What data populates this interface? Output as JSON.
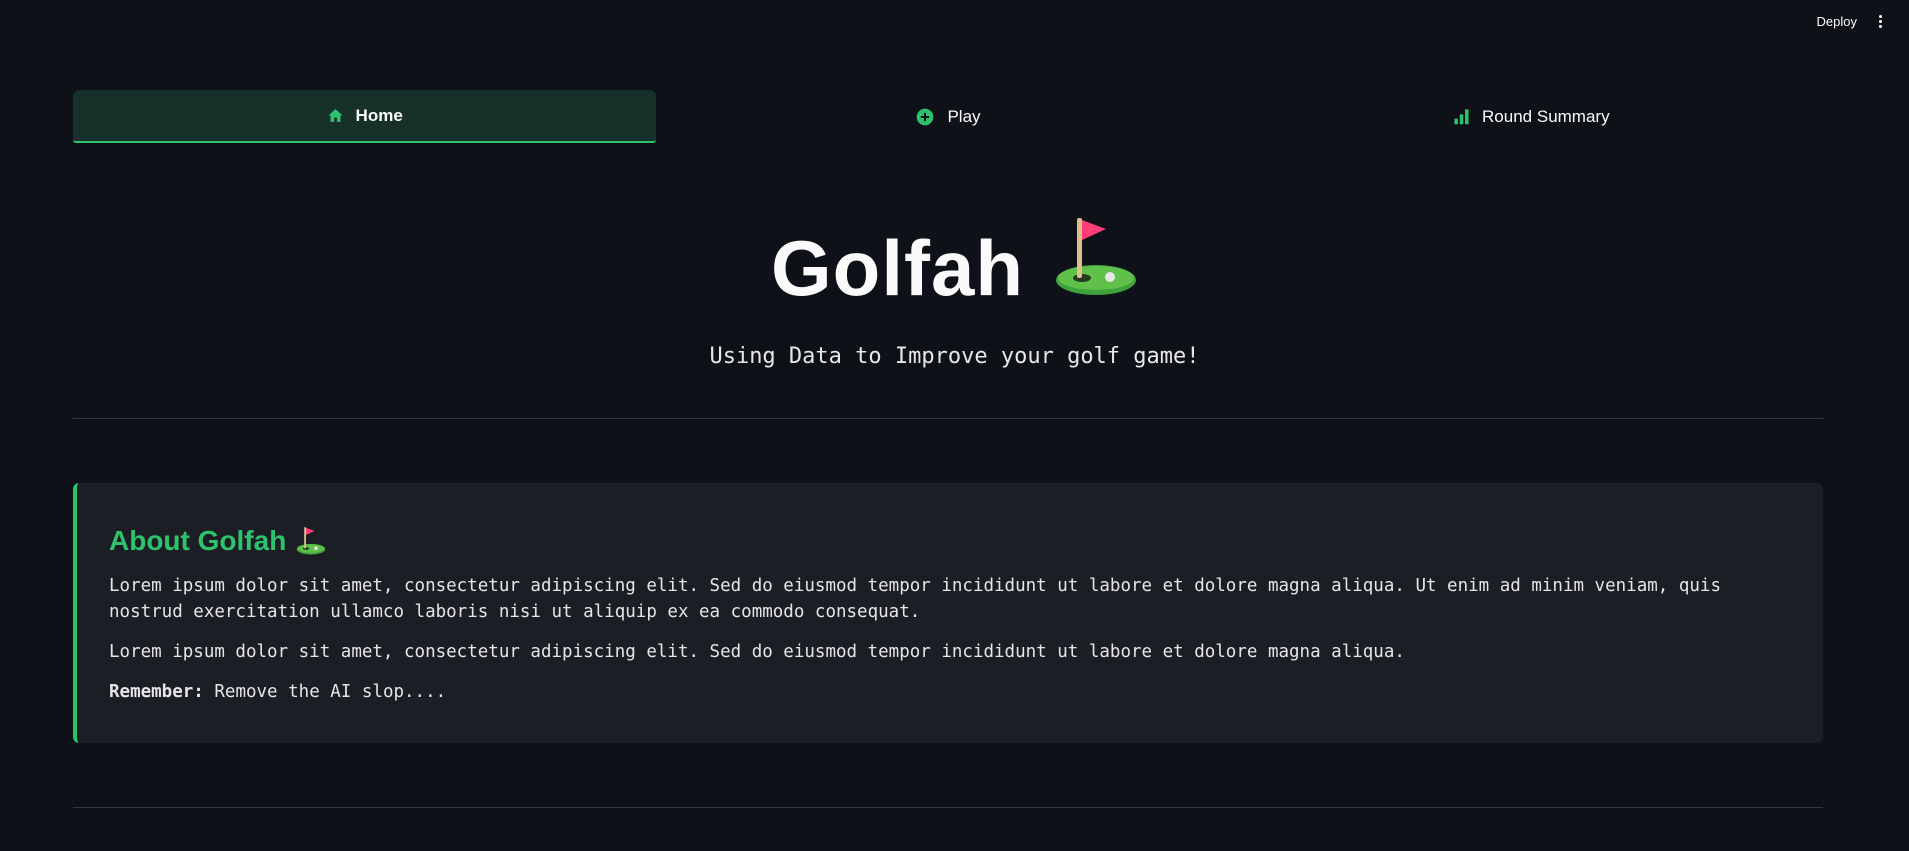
{
  "header": {
    "deploy_label": "Deploy"
  },
  "nav": {
    "tabs": [
      {
        "label": "Home",
        "icon": "home-icon",
        "active": true
      },
      {
        "label": "Play",
        "icon": "plus-circle-icon",
        "active": false
      },
      {
        "label": "Round Summary",
        "icon": "bar-chart-icon",
        "active": false
      }
    ]
  },
  "hero": {
    "title": "Golfah",
    "subtitle": "Using Data to Improve your golf game!"
  },
  "about": {
    "title": "About Golfah",
    "paragraph1": "Lorem ipsum dolor sit amet, consectetur adipiscing elit. Sed do eiusmod tempor incididunt ut labore et dolore magna aliqua. Ut enim ad minim veniam, quis nostrud exercitation ullamco laboris nisi ut aliquip ex ea commodo consequat.",
    "paragraph2": "Lorem ipsum dolor sit amet, consectetur adipiscing elit. Sed do eiusmod tempor incididunt ut labore et dolore magna aliqua.",
    "remember_label": "Remember:",
    "remember_text": "Remove the AI slop...."
  },
  "colors": {
    "background": "#0e1117",
    "accent": "#2ec26d",
    "card": "#1b1e25",
    "active_tab": "#17302a"
  }
}
